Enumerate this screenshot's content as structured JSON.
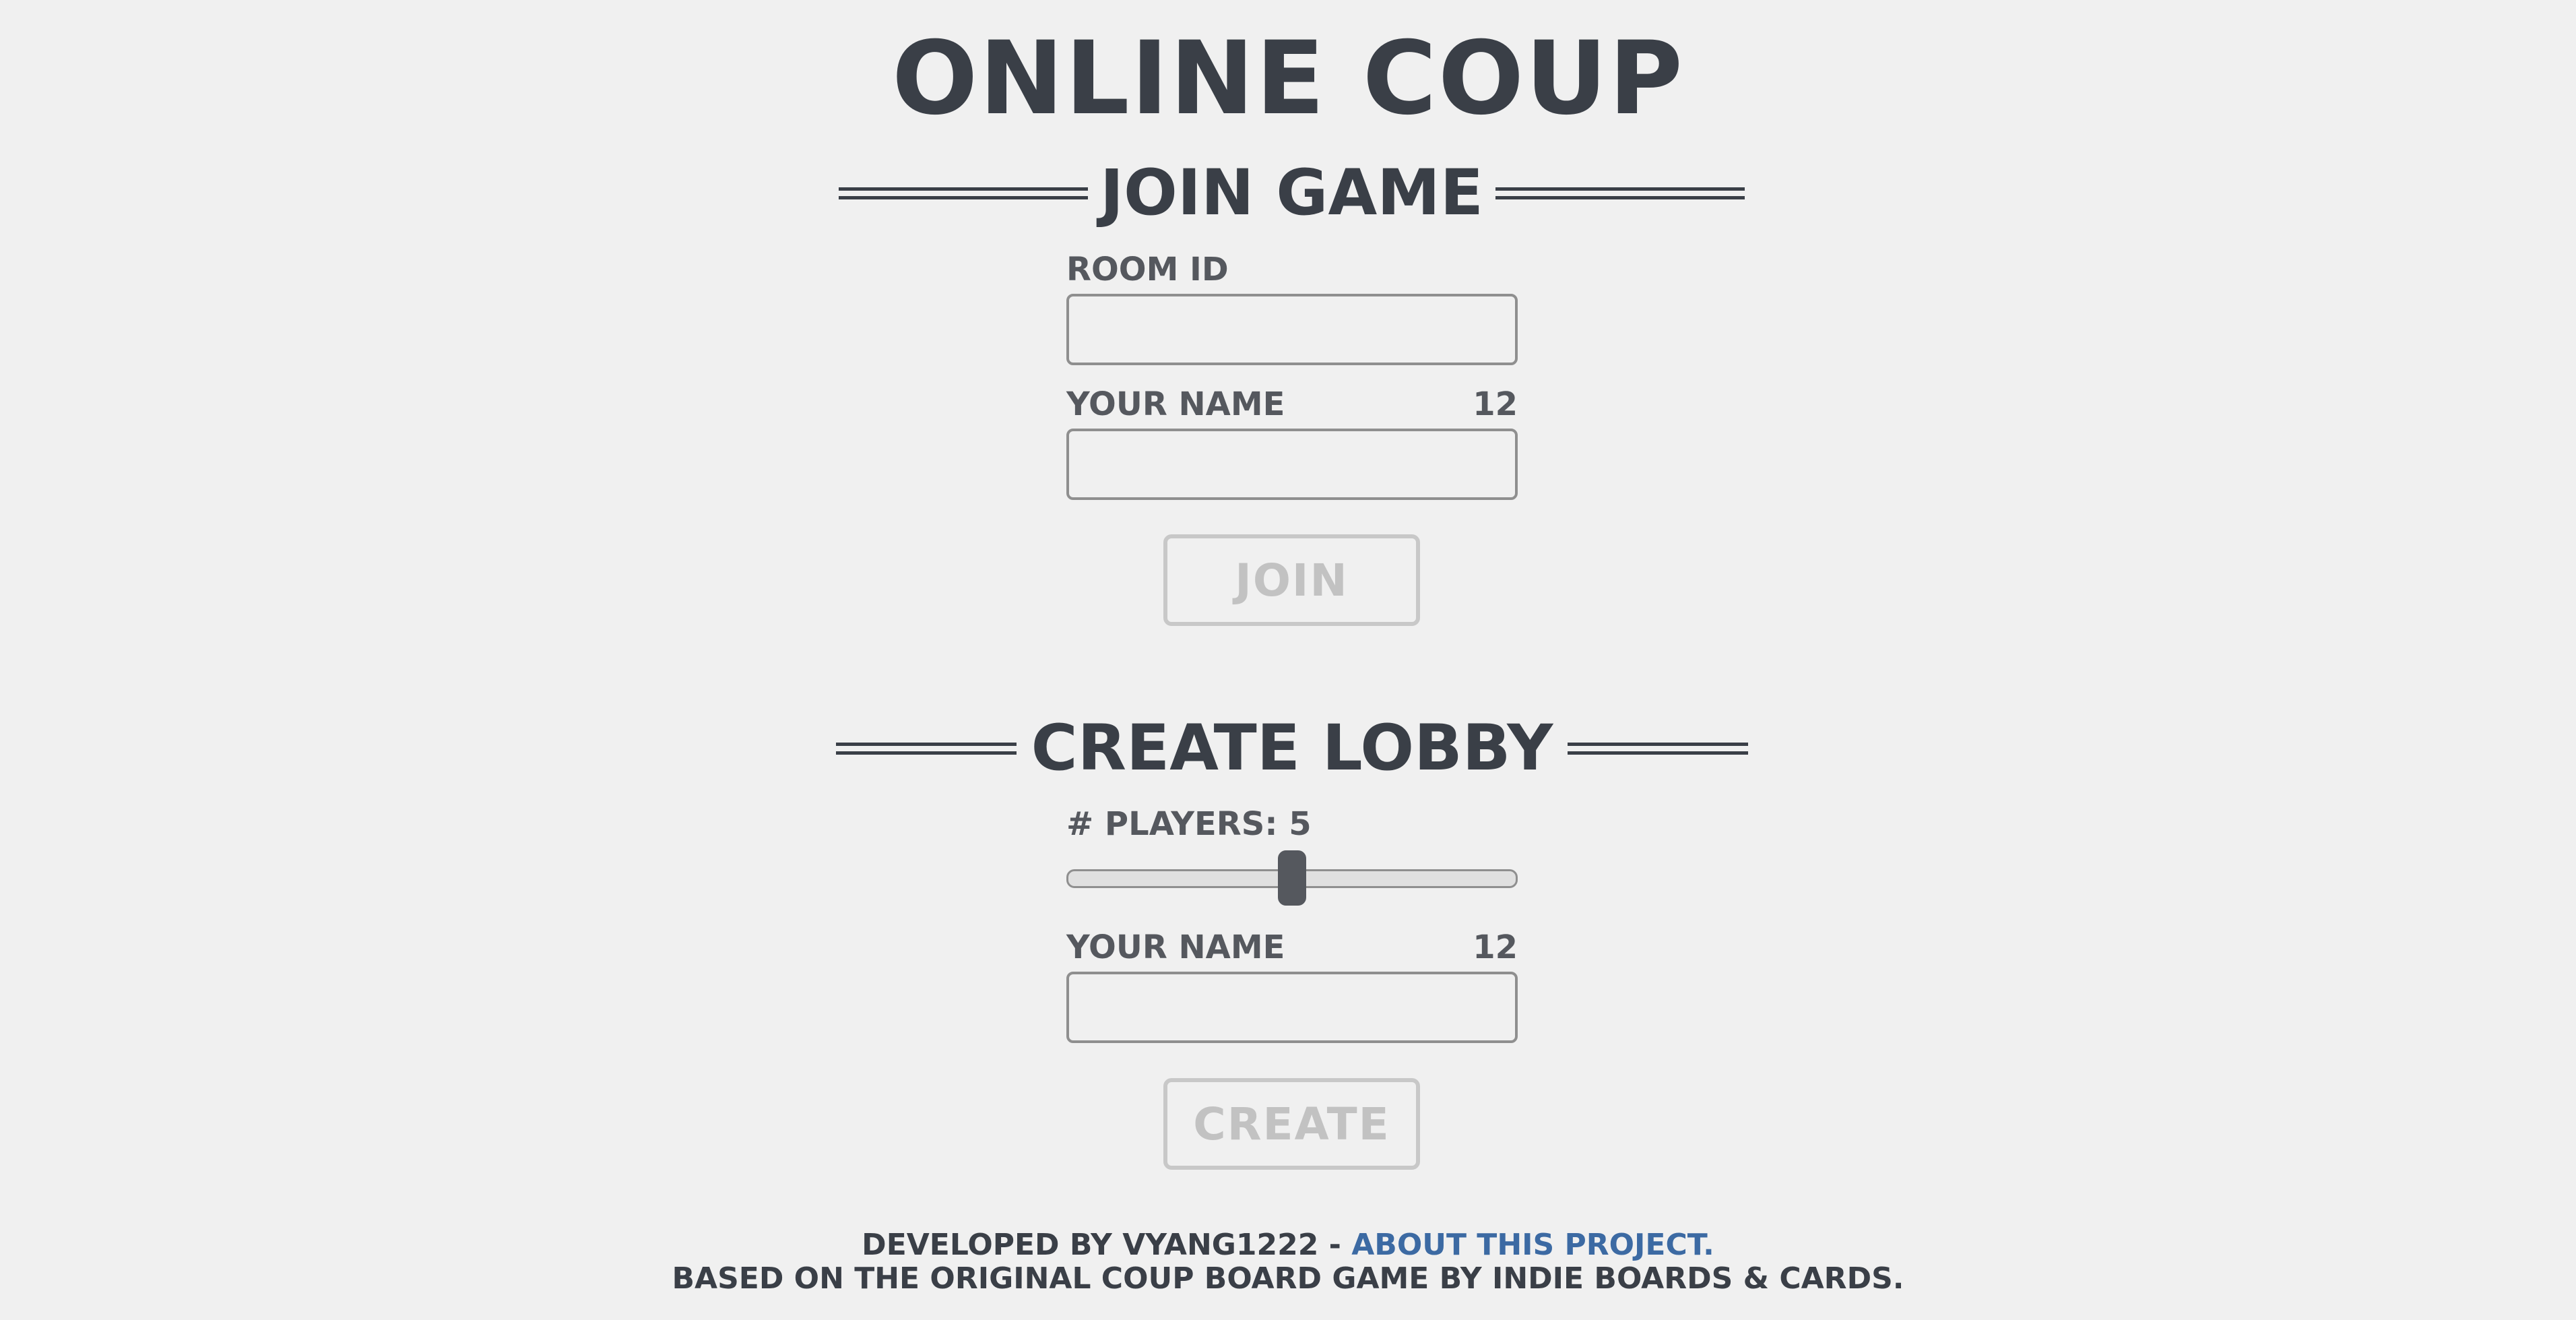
{
  "app": {
    "title": "ONLINE COUP"
  },
  "join": {
    "heading": "JOIN GAME",
    "room_label": "ROOM ID",
    "room_value": "",
    "name_label": "YOUR NAME",
    "name_counter": "12",
    "name_value": "",
    "button_label": "JOIN"
  },
  "lobby": {
    "heading": "CREATE LOBBY",
    "players_label": "# PLAYERS: 5",
    "players_value": 5,
    "players_min": 2,
    "players_max": 8,
    "name_label": "YOUR NAME",
    "name_counter": "12",
    "name_value": "",
    "button_label": "CREATE"
  },
  "footer": {
    "line1_prefix": "DEVELOPED BY VYANG1222 - ",
    "line1_link": "ABOUT THIS PROJECT.",
    "line2": "BASED ON THE ORIGINAL COUP BOARD GAME BY INDIE BOARDS & CARDS."
  },
  "colors": {
    "text": "#3a3f47",
    "label": "#55585e",
    "link": "#3c6aa3",
    "disabled": "#c2c2c2",
    "background": "#f0f0f0"
  }
}
